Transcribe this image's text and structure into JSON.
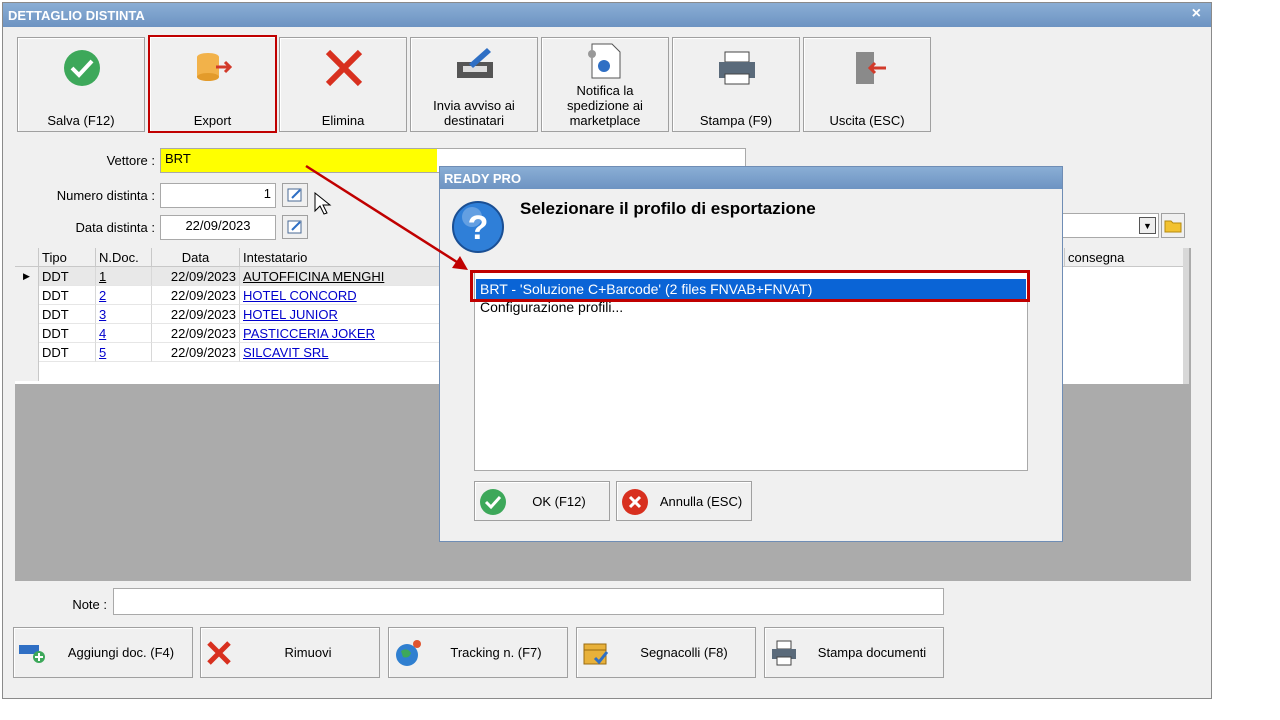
{
  "window": {
    "title": "DETTAGLIO DISTINTA",
    "close_glyph": "×"
  },
  "toolbar": {
    "save_label": "Salva (F12)",
    "export_label": "Export",
    "delete_label": "Elimina",
    "notify_recipients_label": "Invia avviso ai destinatari",
    "notify_marketplace_label": "Notifica la spedizione ai marketplace",
    "print_label": "Stampa (F9)",
    "exit_label": "Uscita (ESC)"
  },
  "form": {
    "carrier_label": "Vettore :",
    "carrier_value": "BRT",
    "number_label": "Numero distinta :",
    "number_value": "1",
    "date_label": "Data distinta :",
    "date_value": "22/09/2023",
    "notes_label": "Note :",
    "notes_value": ""
  },
  "table": {
    "columns": [
      "Tipo",
      "N.Doc.",
      "Data",
      "Intestatario"
    ],
    "right_column": "consegna",
    "rows": [
      {
        "tipo": "DDT",
        "ndoc": "1",
        "data": "22/09/2023",
        "intestatario": "AUTOFFICINA MENGHI"
      },
      {
        "tipo": "DDT",
        "ndoc": "2",
        "data": "22/09/2023",
        "intestatario": "HOTEL CONCORD"
      },
      {
        "tipo": "DDT",
        "ndoc": "3",
        "data": "22/09/2023",
        "intestatario": "HOTEL JUNIOR"
      },
      {
        "tipo": "DDT",
        "ndoc": "4",
        "data": "22/09/2023",
        "intestatario": "PASTICCERIA JOKER"
      },
      {
        "tipo": "DDT",
        "ndoc": "5",
        "data": "22/09/2023",
        "intestatario": "SILCAVIT SRL"
      }
    ]
  },
  "bottom": {
    "add_label": "Aggiungi doc. (F4)",
    "remove_label": "Rimuovi",
    "tracking_label": "Tracking n. (F7)",
    "labels_label": "Segnacolli (F8)",
    "print_docs_label": "Stampa documenti"
  },
  "dialog": {
    "title": "READY PRO",
    "message": "Selezionare il profilo di esportazione",
    "options": [
      "BRT - 'Soluzione C+Barcode' (2 files FNVAB+FNVAT)",
      "Configurazione profili..."
    ],
    "selected_index": 0,
    "ok_label": "OK (F12)",
    "cancel_label": "Annulla (ESC)"
  },
  "colors": {
    "accent_red": "#c00000",
    "selection_blue": "#0a64d6",
    "highlight_yellow": "#ffff00",
    "link_blue": "#0000cc"
  }
}
